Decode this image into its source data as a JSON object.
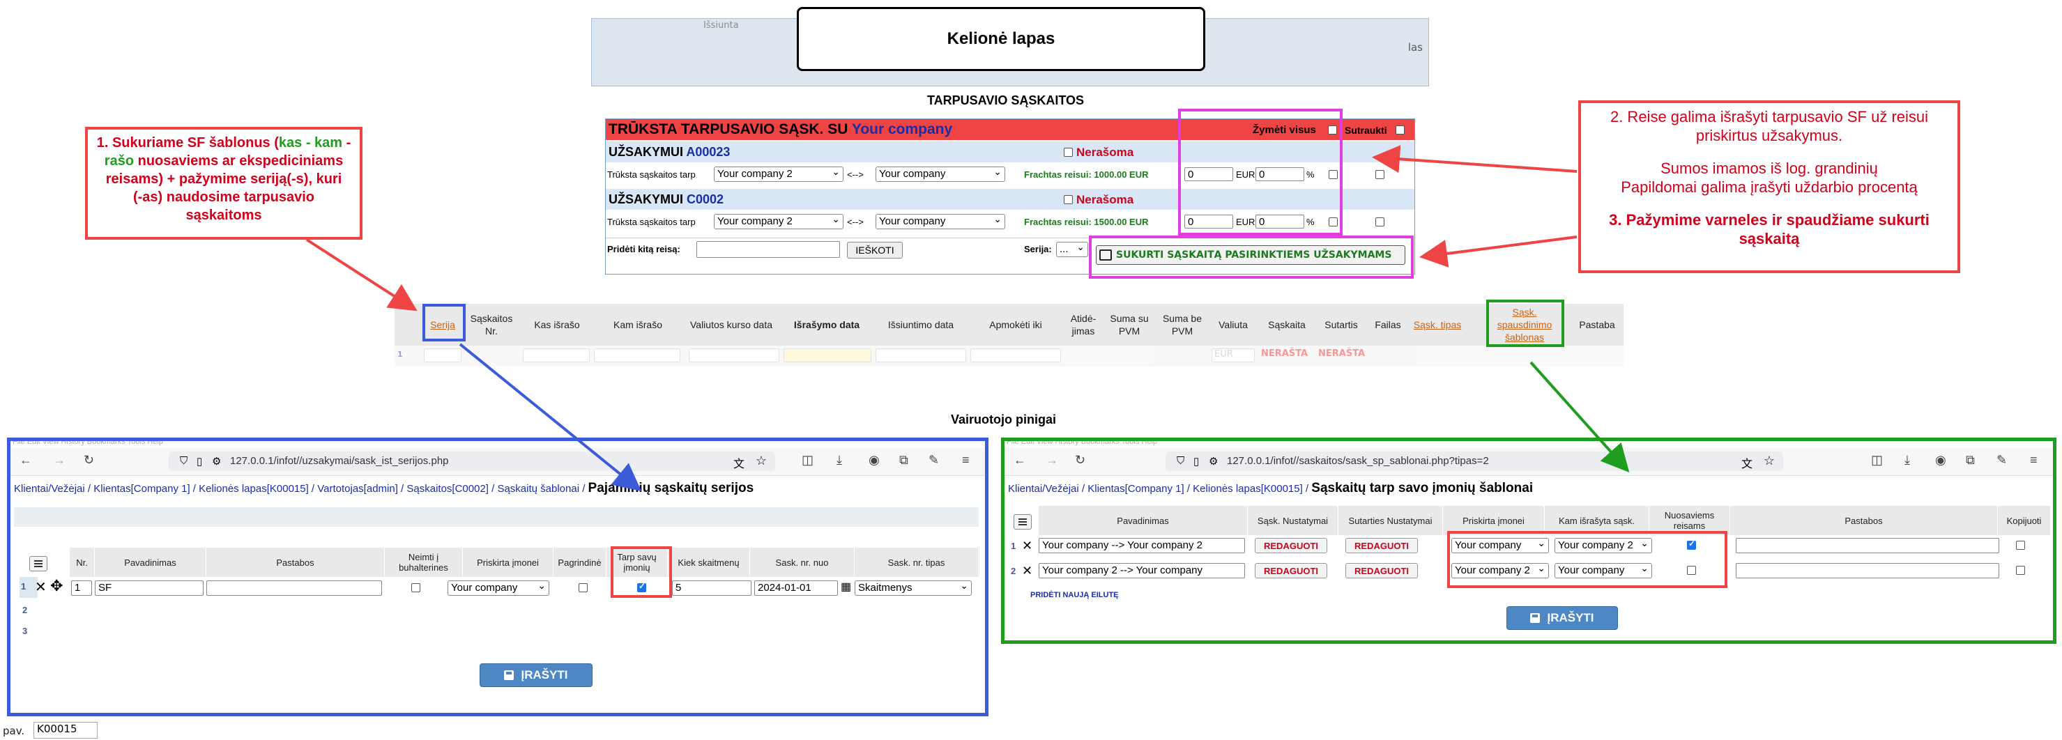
{
  "background": {
    "top_fragment": "Išsiunta",
    "las": "las",
    "title": "Kelionė lapas",
    "tarpusavio_title": "TARPUSAVIO SĄSKAITOS",
    "vairuotojo_title": "Vairuotojo pinigai"
  },
  "panel": {
    "heading": "TRŪKSTA TARPUSAVIO SĄSK. SU",
    "heading_company": "Your company",
    "mark_all": "Žymėti visus",
    "collapse": "Sutraukti",
    "orders": [
      {
        "label": "UŽSAKYMUI",
        "code": "A00023",
        "status": "Nerašoma",
        "row_text": "Trūksta sąskaitos tarp",
        "from": "Your company 2",
        "arrow": "<-->",
        "to": "Your company",
        "freight": "Frachtas reisui: 1000.00 EUR",
        "eur_value": "0",
        "eur": "EUR",
        "pct_value": "0",
        "pct": "%"
      },
      {
        "label": "UŽSAKYMUI",
        "code": "C0002",
        "status": "Nerašoma",
        "row_text": "Trūksta sąskaitos tarp",
        "from": "Your company 2",
        "arrow": "<-->",
        "to": "Your company",
        "freight": "Frachtas reisui: 1500.00 EUR",
        "eur_value": "0",
        "eur": "EUR",
        "pct_value": "0",
        "pct": "%"
      }
    ],
    "add_trip_label": "Pridėti kitą reisą:",
    "search_button": "IEŠKOTI",
    "series_label": "Serija:",
    "series_value": "...",
    "create_button": "SUKURTI SĄSKAITĄ PASIRINKTIEMS UŽSAKYMAMS"
  },
  "grid": {
    "columns": [
      "Serija",
      "Sąskaitos Nr.",
      "Kas išrašo",
      "Kam išrašo",
      "Valiutos kurso data",
      "Išrašymo data",
      "Išsiuntimo data",
      "Apmokėti iki",
      "Atidė-jimas",
      "Suma su PVM",
      "Suma be PVM",
      "Valiuta",
      "Sąskaita",
      "Sutartis",
      "Failas",
      "Sąsk. tipas",
      "Sąsk. spausdinimo šablonas",
      "Pastaba"
    ],
    "row_currency": "EUR",
    "row_status1": "NERAŠTA",
    "row_status2": "NERAŠTA",
    "row_num": "1"
  },
  "left_window": {
    "menubar": "File  Edit  View  History  Bookmarks  Tools  Help",
    "url": "127.0.0.1/infot//uzsakymai/sask_ist_serijos.php",
    "breadcrumb": "Klientai/Vežėjai / Klientas[Company 1] / Kelionės lapas[K00015] / Vartotojas[admin] / Sąskaitos[C0002] / Sąskaitų šablonai /",
    "page_title": "Pajaminių sąskaitų serijos",
    "columns": [
      "Nr.",
      "Pavadinimas",
      "Pastabos",
      "Neimti į buhalterines",
      "Priskirta įmonei",
      "Pagrindinė",
      "Tarp savų įmonių",
      "Kiek skaitmenų",
      "Sask. nr. nuo",
      "Sask. nr. tipas"
    ],
    "row": {
      "num": "1",
      "nr": "1",
      "name": "SF",
      "notes": "",
      "company": "Your company",
      "digits": "5",
      "from_date": "2024-01-01",
      "type": "Skaitmenys"
    },
    "row_numbers": [
      "1",
      "2",
      "3"
    ],
    "save": "ĮRAŠYTI"
  },
  "right_window": {
    "menubar": "File  Edit  View  History  Bookmarks  Tools  Help",
    "url": "127.0.0.1/infot//saskaitos/sask_sp_sablonai.php?tipas=2",
    "breadcrumb": "Klientai/Vežėjai / Klientas[Company 1] / Kelionės lapas[K00015] /",
    "page_title": "Sąskaitų tarp savo įmonių šablonai",
    "columns": [
      "Pavadinimas",
      "Sąsk. Nustatymai",
      "Sutarties Nustatymai",
      "Priskirta įmonei",
      "Kam išrašyta sąsk.",
      "Nuosaviems reisams",
      "Pastabos",
      "Kopijuoti"
    ],
    "rows": [
      {
        "num": "1",
        "name": "Your company --> Your company 2",
        "btn1": "REDAGUOTI",
        "btn2": "REDAGUOTI",
        "company": "Your company",
        "to": "Your company 2",
        "own": true
      },
      {
        "num": "2",
        "name": "Your company 2 --> Your company",
        "btn1": "REDAGUOTI",
        "btn2": "REDAGUOTI",
        "company": "Your company 2",
        "to": "Your company",
        "own": false
      }
    ],
    "add_row": "PRIDĖTI NAUJĄ EILUTĘ",
    "save": "ĮRAŠYTI"
  },
  "annotations": {
    "a1_l1a": "1. Sukuriame SF šablonus (",
    "a1_l1g": "kas - kam",
    "a1_l2g": "rašo",
    "a1_l2b": " nuosaviems ar ekspediciniams",
    "a1_l3": "reisams) + pažymime seriją(-s), kuri",
    "a1_l4": "(-as) naudosime tarpusavio",
    "a1_l5": "sąskaitoms",
    "a2_l1": "2. Reise galima išrašyti tarpusavio SF už reisui",
    "a2_l2": "priskirtus užsakymus.",
    "a2_l3": "Sumos imamos iš log. grandinių",
    "a2_l4": "Papildomai galima įrašyti uždarbio procentą",
    "a2_l5": "3. Pažymime varneles ir spaudžiame sukurti",
    "a2_l6": "sąskaitą"
  },
  "bottom": {
    "label": "pav.",
    "value": "K00015"
  },
  "colors": {
    "red": "#ef4444",
    "blue": "#3b5bdb",
    "green": "#1f9d1f",
    "magenta": "#e040e0"
  }
}
